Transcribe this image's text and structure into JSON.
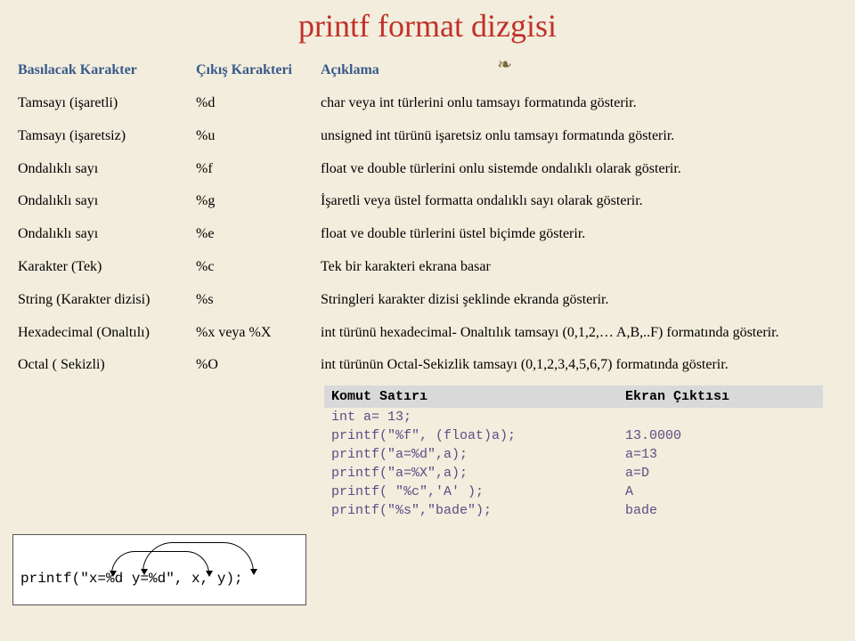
{
  "title": "printf format dizgisi",
  "headers": {
    "col1": "Basılacak Karakter",
    "col2": "Çıkış Karakteri",
    "col3": "Açıklama"
  },
  "rows": [
    {
      "chr": "Tamsayı (işaretli)",
      "out": "%d",
      "desc": "char veya int türlerini onlu tamsayı formatında gösterir."
    },
    {
      "chr": "Tamsayı (işaretsiz)",
      "out": "%u",
      "desc": "unsigned int türünü işaretsiz onlu tamsayı formatında gösterir."
    },
    {
      "chr": "Ondalıklı sayı",
      "out": "%f",
      "desc": "float ve double türlerini onlu sistemde ondalıklı olarak gösterir."
    },
    {
      "chr": "Ondalıklı sayı",
      "out": "%g",
      "desc": "İşaretli veya üstel formatta ondalıklı sayı olarak gösterir."
    },
    {
      "chr": "Ondalıklı sayı",
      "out": "%e",
      "desc": "float ve double türlerini üstel biçimde gösterir."
    },
    {
      "chr": "Karakter (Tek)",
      "out": "%c",
      "desc": "Tek bir karakteri ekrana basar"
    },
    {
      "chr": "String (Karakter dizisi)",
      "out": "%s",
      "desc": "Stringleri karakter dizisi şeklinde ekranda gösterir."
    },
    {
      "chr": "Hexadecimal (Onaltılı)",
      "out": "%x veya %X",
      "desc": "int türünü hexadecimal- Onaltılık tamsayı (0,1,2,… A,B,..F) formatında gösterir."
    },
    {
      "chr": "Octal ( Sekizli)",
      "out": "%O",
      "desc": "int türünün Octal-Sekizlik tamsayı (0,1,2,3,4,5,6,7) formatında gösterir."
    }
  ],
  "subheaders": {
    "col1": "Komut Satırı",
    "col2": "Ekran Çıktısı"
  },
  "subrows": [
    {
      "cmd": "int a= 13;",
      "out": ""
    },
    {
      "cmd": "printf(\"%f\", (float)a);",
      "out": "13.0000"
    },
    {
      "cmd": "printf(\"a=%d\",a);",
      "out": "a=13"
    },
    {
      "cmd": "printf(\"a=%X\",a);",
      "out": "a=D"
    },
    {
      "cmd": "printf( \"%c\",'A' );",
      "out": "A"
    },
    {
      "cmd": "printf(\"%s\",\"bade\");",
      "out": "bade"
    }
  ],
  "printfExample": "printf(\"x=%d y=%d\", x, y);"
}
